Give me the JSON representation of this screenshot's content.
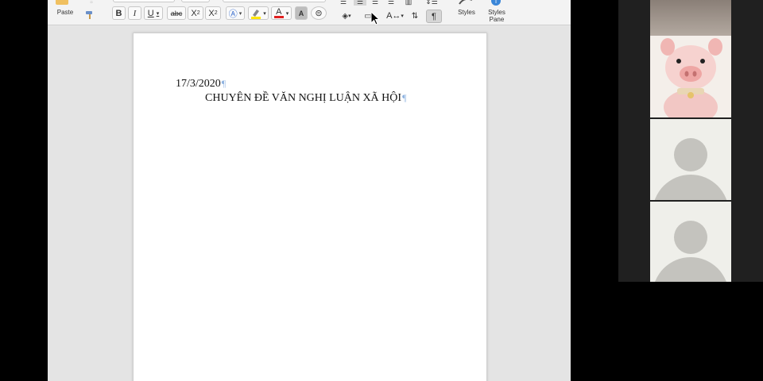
{
  "ribbon": {
    "paste_label": "Paste",
    "styles_label": "Styles",
    "styles_pane_label": "Styles\nPane",
    "bold": "B",
    "italic": "I",
    "underline": "U",
    "strikethrough": "abc",
    "subscript": "X",
    "subscript_mark": "2",
    "superscript": "X",
    "superscript_mark": "2",
    "font_color": "A",
    "char_shading": "A",
    "pilcrow": "¶"
  },
  "document": {
    "date_line": "17/3/2020",
    "title_line": "CHUYÊN ĐỀ VĂN NGHỊ LUẬN XÃ HỘI",
    "paragraph_mark": "¶"
  },
  "colors": {
    "font_color_bar": "#e02020",
    "highlight_bar": "#ffe600",
    "selected_button": "#d6d6d6",
    "pilcrow_color": "#8fb3e0"
  },
  "participants": {
    "tiles": [
      "camera-feed",
      "pig-avatar",
      "participant-placeholder",
      "participant-placeholder"
    ]
  }
}
